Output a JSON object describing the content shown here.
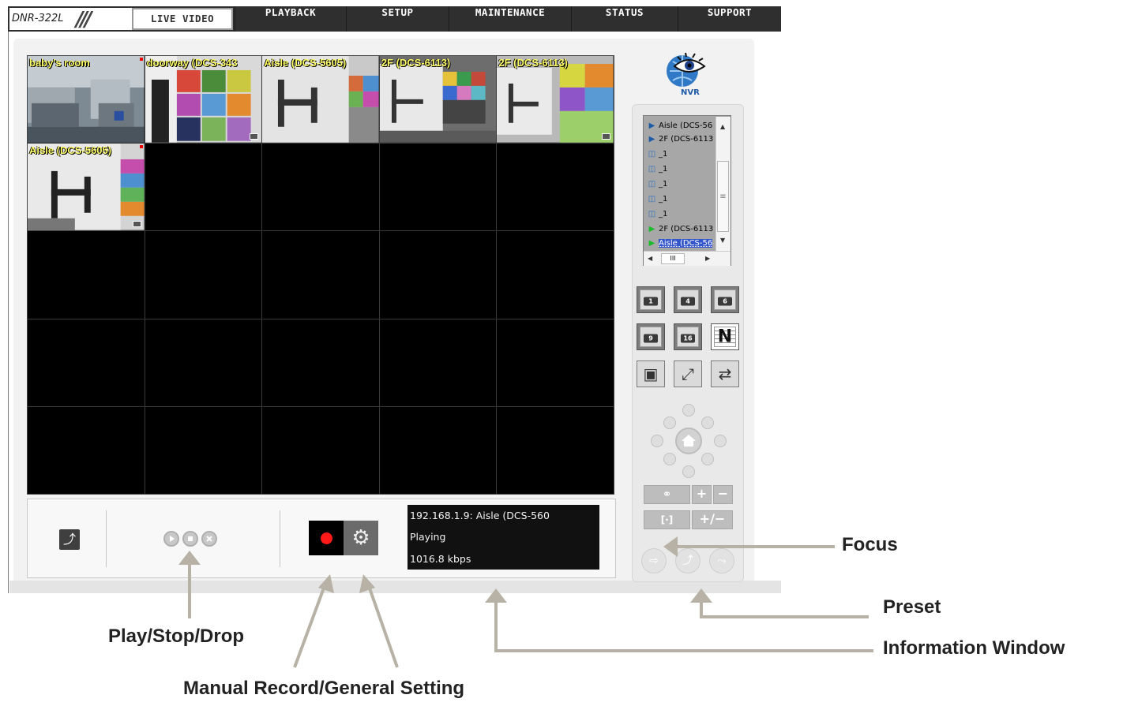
{
  "app": {
    "model": "DNR-322L"
  },
  "nav": {
    "tabs": [
      {
        "label": "LIVE VIDEO",
        "active": true
      },
      {
        "label": "PLAYBACK"
      },
      {
        "label": "SETUP"
      },
      {
        "label": "MAINTENANCE"
      },
      {
        "label": "STATUS"
      },
      {
        "label": "SUPPORT"
      }
    ]
  },
  "cameras": [
    {
      "label": "baby's room"
    },
    {
      "label": "doorway (DCS-343"
    },
    {
      "label": "Aisle (DCS-5605)"
    },
    {
      "label": "2F (DCS-6113)"
    },
    {
      "label": "2F (DCS-6113)"
    },
    {
      "label": "Aisle (DCS-5605)"
    }
  ],
  "info_window": {
    "line1": "192.168.1.9: Aisle (DCS-560",
    "line2": "Playing",
    "line3": "1016.8 kbps"
  },
  "logo": {
    "text": "NVR"
  },
  "tree": {
    "items": [
      {
        "label": "Aisle (DCS-56",
        "icon": "blue-play-icon"
      },
      {
        "label": "2F (DCS-6113",
        "icon": "blue-play-icon"
      },
      {
        "label": "_1",
        "icon": "io-icon"
      },
      {
        "label": "_1",
        "icon": "io-icon"
      },
      {
        "label": "_1",
        "icon": "io-icon"
      },
      {
        "label": "_1",
        "icon": "io-icon"
      },
      {
        "label": "_1",
        "icon": "io-icon"
      },
      {
        "label": "2F (DCS-6113",
        "icon": "green-play-icon"
      },
      {
        "label": "Aisle (DCS-56",
        "icon": "green-play-icon",
        "selected": true
      }
    ],
    "scroll_grip": "≡",
    "hscroll_grip": "III"
  },
  "layouts": {
    "l1": "1",
    "l4": "4",
    "l6": "6",
    "l9": "9",
    "l16": "16",
    "ln": "N"
  },
  "annotations": {
    "focus": "Focus",
    "preset": "Preset",
    "info": "Information Window",
    "play": "Play/Stop/Drop",
    "record": "Manual Record/General Setting"
  },
  "colors": {
    "camera_label": "#ffff66",
    "record_dot": "#ff1a1a",
    "annotation_line": "#b8b2a6"
  }
}
